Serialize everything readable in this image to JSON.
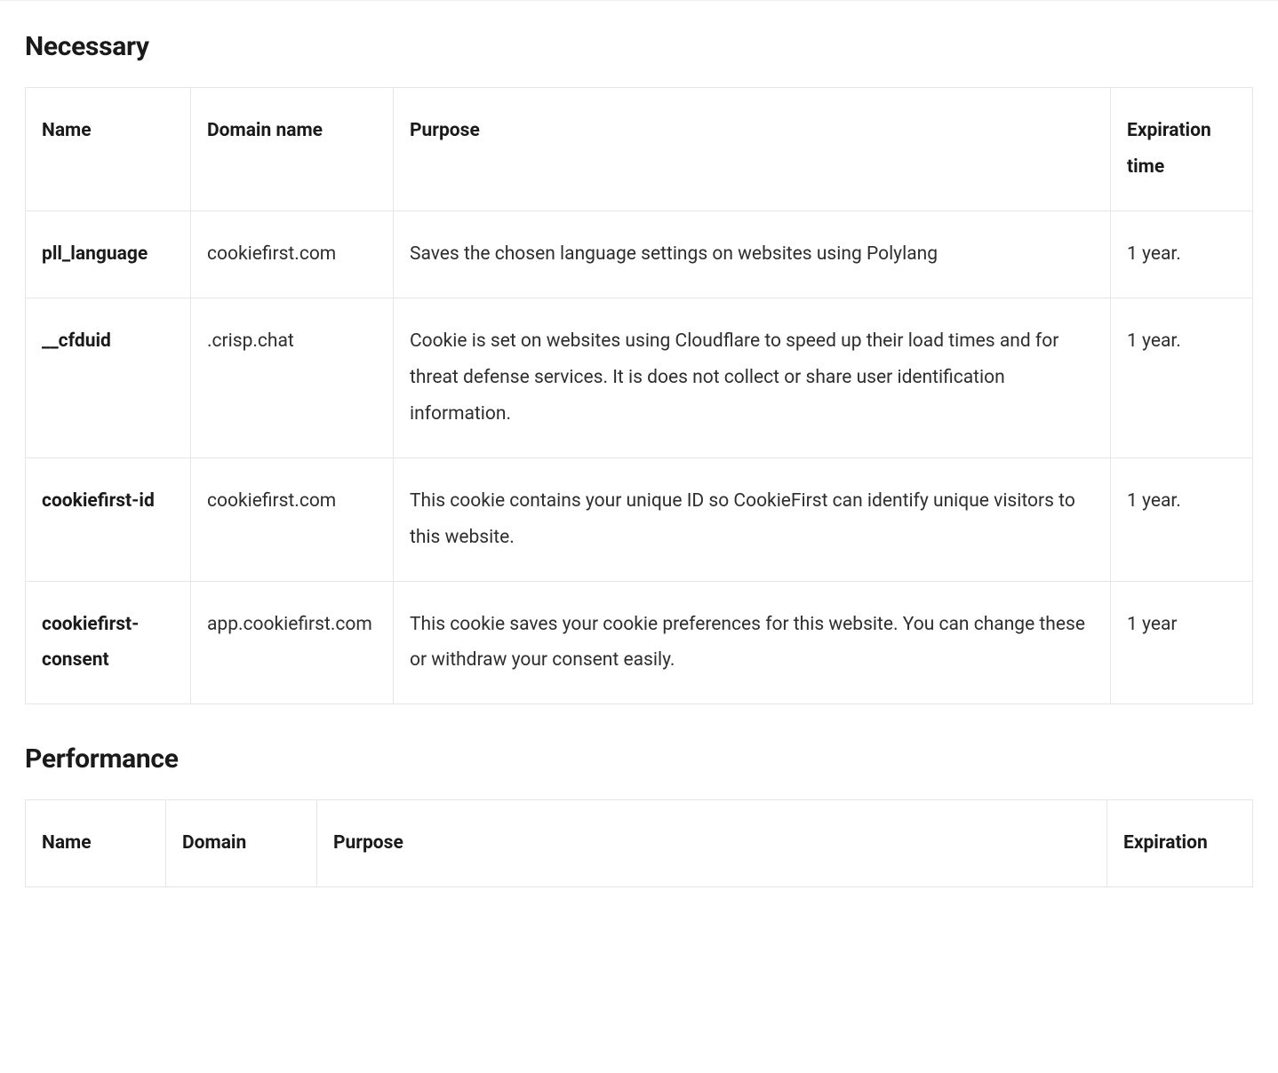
{
  "sections": [
    {
      "heading": "Necessary",
      "columns": [
        "Name",
        "Domain name",
        "Purpose",
        "Expiration time"
      ],
      "rows": [
        {
          "name": "pll_language",
          "domain": "cookiefirst.com",
          "purpose": "Saves the chosen language settings on websites using Polylang",
          "expiration": "1 year."
        },
        {
          "name": "__cfduid",
          "domain": ".crisp.chat",
          "purpose": "Cookie is set on websites using Cloudflare to speed up their load times and for threat defense services. It is does not collect or share user identification information.",
          "expiration": "1 year."
        },
        {
          "name": "cookiefirst-id",
          "domain": "cookiefirst.com",
          "purpose": "This cookie contains your unique ID so CookieFirst can identify unique visitors to this website.",
          "expiration": "1 year."
        },
        {
          "name": "cookiefirst-consent",
          "domain": "app.cookiefirst.com",
          "purpose": "This cookie saves your cookie preferences for this website. You can change these or withdraw your consent easily.",
          "expiration": "1 year"
        }
      ]
    },
    {
      "heading": "Performance",
      "columns": [
        "Name",
        "Domain",
        "Purpose",
        "Expiration"
      ],
      "rows": []
    }
  ]
}
